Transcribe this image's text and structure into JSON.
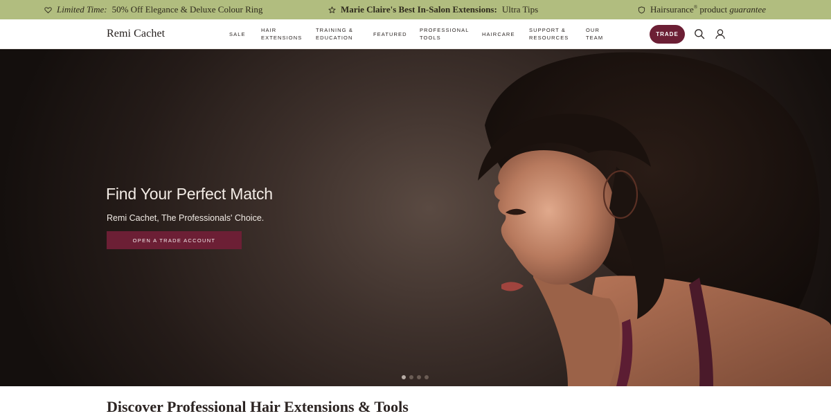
{
  "announcement": {
    "item1": {
      "italic": "Limited Time:",
      "rest": "50% Off Elegance & Deluxe Colour Ring",
      "icon": "heart-icon"
    },
    "item2": {
      "bold": "Marie Claire's Best In-Salon Extensions:",
      "rest": "Ultra Tips",
      "icon": "star-icon"
    },
    "item3": {
      "brand": "Hairsurance",
      "mark": "®",
      "rest": "product",
      "italic": "guarantee",
      "icon": "shield-icon"
    },
    "background": "#b1bd7f"
  },
  "header": {
    "logo": "Remi Cachet",
    "nav": {
      "sale": [
        "SALE"
      ],
      "hair_extensions": [
        "HAIR",
        "EXTENSIONS"
      ],
      "training": [
        "TRAINING &",
        "EDUCATION"
      ],
      "featured": [
        "FEATURED"
      ],
      "professional_tools": [
        "PROFESSIONAL",
        "TOOLS"
      ],
      "haircare": [
        "HAIRCARE"
      ],
      "support": [
        "SUPPORT &",
        "RESOURCES"
      ],
      "our_team": [
        "OUR",
        "TEAM"
      ]
    },
    "trade_label": "TRADE",
    "accent": "#6c1f35"
  },
  "hero": {
    "title": "Find Your Perfect Match",
    "subtitle": "Remi Cachet, The Professionals' Choice.",
    "cta": "OPEN A TRADE ACCOUNT",
    "slides": 4,
    "active_slide": 1
  },
  "section": {
    "title": "Discover Professional Hair Extensions & Tools"
  }
}
